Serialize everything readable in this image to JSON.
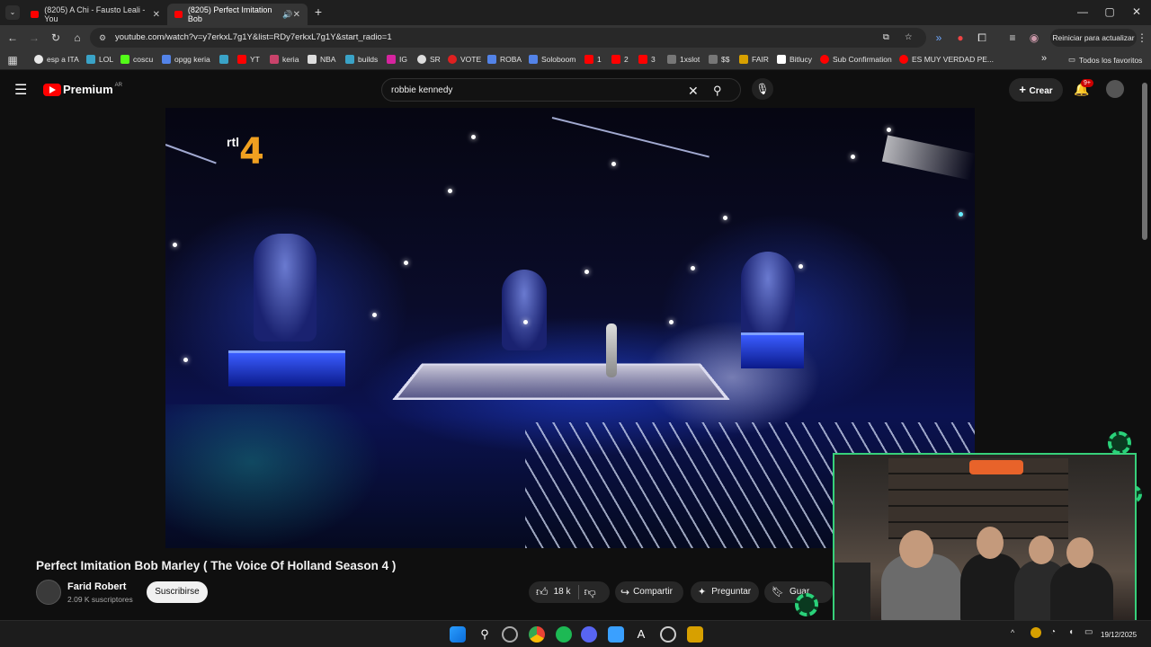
{
  "browser": {
    "tabs": [
      {
        "title": "(8205) A Chi - Fausto Leali - You",
        "active": false
      },
      {
        "title": "(8205) Perfect Imitation Bob",
        "active": true
      }
    ],
    "new_tab": "+",
    "url": "youtube.com/watch?v=y7erkxL7g1Y&list=RDy7erkxL7g1Y&start_radio=1",
    "restart_label": "Reiniciar para actualizar",
    "window_controls": [
      "—",
      "▢",
      "✕"
    ],
    "bookmarks": [
      {
        "label": "esp a ITA",
        "color": "#e8e8e8"
      },
      {
        "label": "LOL",
        "color": "#3aa3c7"
      },
      {
        "label": "coscu",
        "color": "#53fc18"
      },
      {
        "label": "opgg keria",
        "color": "#5383e8"
      },
      {
        "label": "YT",
        "color": "#ff0000"
      },
      {
        "label": "keria",
        "color": "#c9436b"
      },
      {
        "label": "NBA",
        "color": "#dddddd"
      },
      {
        "label": "builds",
        "color": "#3aa3c7"
      },
      {
        "label": "IG",
        "color": "#d6249f"
      },
      {
        "label": "SR",
        "color": "#dddddd"
      },
      {
        "label": "VOTE",
        "color": "#e02020"
      },
      {
        "label": "ROBA",
        "color": "#5383e8"
      },
      {
        "label": "Soloboom",
        "color": "#5383e8"
      },
      {
        "label": "1",
        "color": "#ff0000"
      },
      {
        "label": "2",
        "color": "#ff0000"
      },
      {
        "label": "3",
        "color": "#ff0000"
      },
      {
        "label": "1xslot",
        "color": "#777777"
      },
      {
        "label": "$$",
        "color": "#777777"
      },
      {
        "label": "FAIR",
        "color": "#d7a000"
      },
      {
        "label": "Bitlucy",
        "color": "#ffffff"
      },
      {
        "label": "Sub Confirmation",
        "color": "#ff0000"
      },
      {
        "label": "ES MUY VERDAD PE...",
        "color": "#ff0000"
      }
    ],
    "bookmarks_more": "»",
    "all_favorites": "Todos los favoritos"
  },
  "youtube": {
    "logo_text": "Premium",
    "region": "AR",
    "search_query": "robbie kennedy",
    "create_label": "Crear",
    "notif_badge": "9+"
  },
  "video": {
    "channel_logo_small": "rtl",
    "channel_logo_big": "4",
    "title": "Perfect Imitation Bob Marley ( The Voice Of Holland Season 4 )",
    "channel": "Farid Robert",
    "subscribers": "2.09 K suscriptores",
    "subscribe_label": "Suscribirse",
    "likes": "18 k",
    "share_label": "Compartir",
    "ask_label": "Preguntar",
    "save_label": "Guar"
  },
  "taskbar": {
    "time": "19/12/2025"
  },
  "colors": {
    "accent_red": "#ff0000",
    "cam_border": "#37d07a"
  }
}
